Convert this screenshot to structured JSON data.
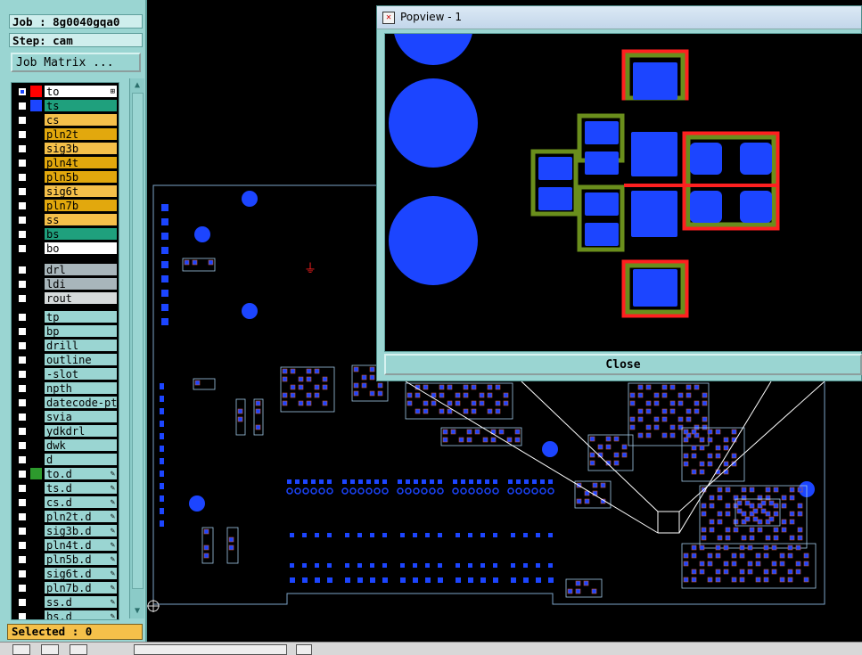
{
  "job_label": "Job : 8g0040gqa0",
  "step_label": "Step: cam",
  "job_matrix_button": "Job Matrix ...",
  "selected_label": "Selected : 0",
  "layers_group1": [
    {
      "name": "to",
      "bg": "#ffffff",
      "swatch": "#ff0000",
      "mark": "⊞",
      "checked": true
    },
    {
      "name": "ts",
      "bg": "#1fa07d",
      "swatch": "#1c45ff"
    },
    {
      "name": "cs",
      "bg": "#f5c04a",
      "swatch": ""
    },
    {
      "name": "pln2t",
      "bg": "#e2a80d",
      "swatch": ""
    },
    {
      "name": "sig3b",
      "bg": "#f5c04a",
      "swatch": ""
    },
    {
      "name": "pln4t",
      "bg": "#e2a80d",
      "swatch": ""
    },
    {
      "name": "pln5b",
      "bg": "#e2a80d",
      "swatch": ""
    },
    {
      "name": "sig6t",
      "bg": "#f5c04a",
      "swatch": ""
    },
    {
      "name": "pln7b",
      "bg": "#e2a80d",
      "swatch": ""
    },
    {
      "name": "ss",
      "bg": "#f5c04a",
      "swatch": ""
    },
    {
      "name": "bs",
      "bg": "#1fa07d",
      "swatch": ""
    },
    {
      "name": "bo",
      "bg": "#ffffff",
      "swatch": ""
    }
  ],
  "layers_group2": [
    {
      "name": "drl",
      "bg": "#a8b6bb",
      "swatch": ""
    },
    {
      "name": "ldi",
      "bg": "#a8b6bb",
      "swatch": ""
    },
    {
      "name": "rout",
      "bg": "#d6dadb",
      "swatch": ""
    }
  ],
  "layers_group3": [
    {
      "name": "tp",
      "bg": "#9ad5d2",
      "swatch": ""
    },
    {
      "name": "bp",
      "bg": "#9ad5d2",
      "swatch": ""
    },
    {
      "name": "drill",
      "bg": "#9ad5d2",
      "swatch": ""
    },
    {
      "name": "outline",
      "bg": "#9ad5d2",
      "swatch": ""
    },
    {
      "name": "-slot",
      "bg": "#9ad5d2",
      "swatch": ""
    },
    {
      "name": "npth",
      "bg": "#9ad5d2",
      "swatch": ""
    },
    {
      "name": "datecode-pto",
      "bg": "#9ad5d2",
      "swatch": ""
    },
    {
      "name": "svia",
      "bg": "#9ad5d2",
      "swatch": ""
    },
    {
      "name": "ydkdrl",
      "bg": "#9ad5d2",
      "swatch": ""
    },
    {
      "name": "dwk",
      "bg": "#9ad5d2",
      "swatch": ""
    },
    {
      "name": "d",
      "bg": "#9ad5d2",
      "swatch": ""
    },
    {
      "name": "to.d",
      "bg": "#9ad5d2",
      "swatch": "#2d9a2d",
      "mark": "✎"
    },
    {
      "name": "ts.d",
      "bg": "#9ad5d2",
      "swatch": "",
      "mark": "✎"
    },
    {
      "name": "cs.d",
      "bg": "#9ad5d2",
      "swatch": "",
      "mark": "✎"
    },
    {
      "name": "pln2t.d",
      "bg": "#9ad5d2",
      "swatch": "",
      "mark": "✎"
    },
    {
      "name": "sig3b.d",
      "bg": "#9ad5d2",
      "swatch": "",
      "mark": "✎"
    },
    {
      "name": "pln4t.d",
      "bg": "#9ad5d2",
      "swatch": "",
      "mark": "✎"
    },
    {
      "name": "pln5b.d",
      "bg": "#9ad5d2",
      "swatch": "",
      "mark": "✎"
    },
    {
      "name": "sig6t.d",
      "bg": "#9ad5d2",
      "swatch": "",
      "mark": "✎"
    },
    {
      "name": "pln7b.d",
      "bg": "#9ad5d2",
      "swatch": "",
      "mark": "✎"
    },
    {
      "name": "ss.d",
      "bg": "#9ad5d2",
      "swatch": "",
      "mark": "✎"
    },
    {
      "name": "bs.d",
      "bg": "#9ad5d2",
      "swatch": "",
      "mark": "✎"
    }
  ],
  "popup": {
    "title": "Popview - 1",
    "close_label": "Close"
  },
  "colors": {
    "pad": "#1c45ff",
    "outline": "#7da3c8",
    "silk_red": "#ff2020",
    "silk_green": "#6a8e1c"
  }
}
